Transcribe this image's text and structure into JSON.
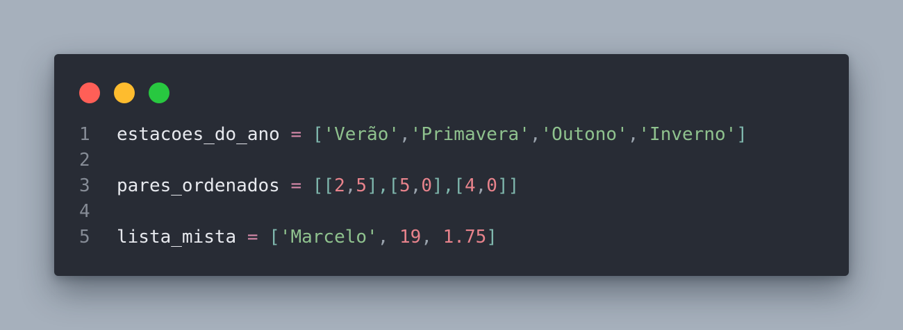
{
  "window": {
    "background": "#282c35",
    "controls": [
      {
        "name": "close",
        "color": "#ff5f57"
      },
      {
        "name": "minimize",
        "color": "#febc2e"
      },
      {
        "name": "maximize",
        "color": "#28c840"
      }
    ]
  },
  "colors": {
    "identifier": "#e7e9ee",
    "operator": "#d88aaa",
    "bracket": "#7fb7ad",
    "string": "#8fc28e",
    "number": "#e8838c",
    "punct": "#9aa3ad",
    "line_number": "#868c96"
  },
  "code": {
    "lines": [
      {
        "number": "1",
        "tokens": [
          {
            "text": "estacoes_do_ano",
            "kind": "identifier"
          },
          {
            "text": " ",
            "kind": "identifier"
          },
          {
            "text": "=",
            "kind": "operator"
          },
          {
            "text": " ",
            "kind": "identifier"
          },
          {
            "text": "[",
            "kind": "bracket"
          },
          {
            "text": "'Verão'",
            "kind": "string"
          },
          {
            "text": ",",
            "kind": "punct"
          },
          {
            "text": "'Primavera'",
            "kind": "string"
          },
          {
            "text": ",",
            "kind": "punct"
          },
          {
            "text": "'Outono'",
            "kind": "string"
          },
          {
            "text": ",",
            "kind": "punct"
          },
          {
            "text": "'Inverno'",
            "kind": "string"
          },
          {
            "text": "]",
            "kind": "bracket"
          }
        ]
      },
      {
        "number": "2",
        "tokens": []
      },
      {
        "number": "3",
        "tokens": [
          {
            "text": "pares_ordenados",
            "kind": "identifier"
          },
          {
            "text": " ",
            "kind": "identifier"
          },
          {
            "text": "=",
            "kind": "operator"
          },
          {
            "text": " ",
            "kind": "identifier"
          },
          {
            "text": "[[",
            "kind": "bracket"
          },
          {
            "text": "2",
            "kind": "number"
          },
          {
            "text": ",",
            "kind": "punct"
          },
          {
            "text": "5",
            "kind": "number"
          },
          {
            "text": "],[",
            "kind": "bracket"
          },
          {
            "text": "5",
            "kind": "number"
          },
          {
            "text": ",",
            "kind": "punct"
          },
          {
            "text": "0",
            "kind": "number"
          },
          {
            "text": "],[",
            "kind": "bracket"
          },
          {
            "text": "4",
            "kind": "number"
          },
          {
            "text": ",",
            "kind": "punct"
          },
          {
            "text": "0",
            "kind": "number"
          },
          {
            "text": "]]",
            "kind": "bracket"
          }
        ]
      },
      {
        "number": "4",
        "tokens": []
      },
      {
        "number": "5",
        "tokens": [
          {
            "text": "lista_mista",
            "kind": "identifier"
          },
          {
            "text": " ",
            "kind": "identifier"
          },
          {
            "text": "=",
            "kind": "operator"
          },
          {
            "text": " ",
            "kind": "identifier"
          },
          {
            "text": "[",
            "kind": "bracket"
          },
          {
            "text": "'Marcelo'",
            "kind": "string"
          },
          {
            "text": ", ",
            "kind": "punct"
          },
          {
            "text": "19",
            "kind": "number"
          },
          {
            "text": ", ",
            "kind": "punct"
          },
          {
            "text": "1.75",
            "kind": "number"
          },
          {
            "text": "]",
            "kind": "bracket"
          }
        ]
      }
    ]
  }
}
